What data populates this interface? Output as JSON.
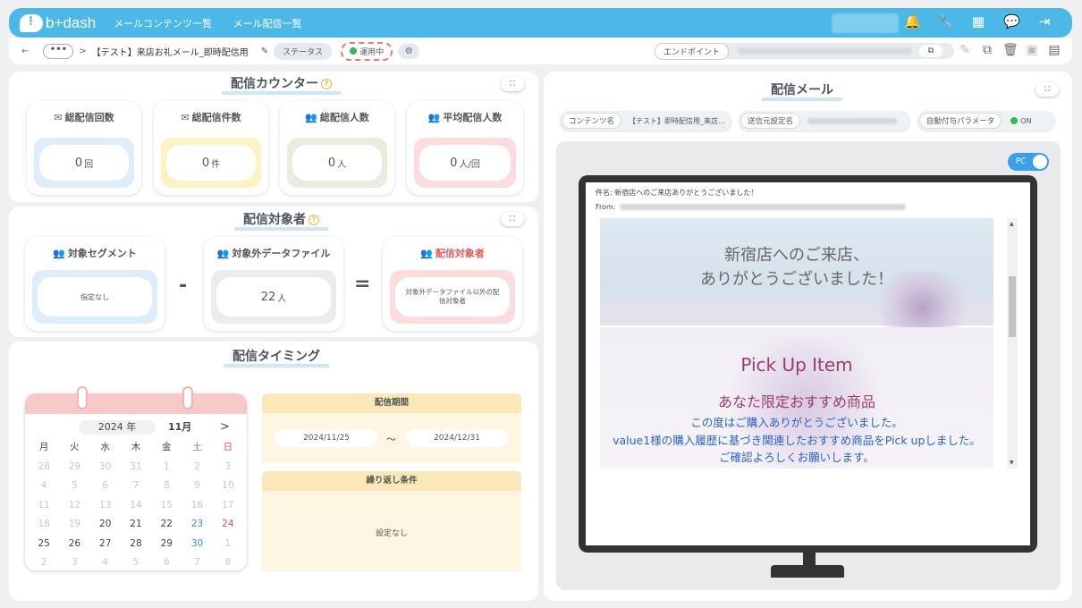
{
  "app": {
    "logo": "b+dash"
  },
  "topnav": [
    "メールコンテンツ一覧",
    "メール配信一覧"
  ],
  "breadcrumb": {
    "back": "←",
    "more": "•••",
    "sep": ">",
    "title": "【テスト】来店お礼メール_即時配信用",
    "status_label": "ステータス",
    "status_value": "運用中",
    "endpoint_label": "エンドポイント"
  },
  "counter": {
    "title": "配信カウンター",
    "cards": [
      {
        "label": "総配信回数",
        "value": "0",
        "unit": "回",
        "color": "#deedf9"
      },
      {
        "label": "総配信件数",
        "value": "0",
        "unit": "件",
        "color": "#fdf2c4"
      },
      {
        "label": "総配信人数",
        "value": "0",
        "unit": "人",
        "color": "#e8eedd"
      },
      {
        "label": "平均配信人数",
        "value": "0",
        "unit": "人/回",
        "color": "#fcdcdc"
      }
    ]
  },
  "target": {
    "title": "配信対象者",
    "segment_label": "対象セグメント",
    "segment_value": "指定なし",
    "exclude_label": "対象外データファイル",
    "exclude_value": "22",
    "exclude_unit": "人",
    "result_label": "配信対象者",
    "result_value": "対象外データファイル以外の配信対象者",
    "minus": "-",
    "equals": "="
  },
  "timing": {
    "title": "配信タイミング",
    "calendar": {
      "year": "2024 年",
      "month": "11月",
      "next": ">",
      "weekdays": [
        "月",
        "火",
        "水",
        "木",
        "金",
        "土",
        "日"
      ],
      "weeks": [
        [
          "28",
          "29",
          "30",
          "31",
          "1",
          "2",
          "3"
        ],
        [
          "4",
          "5",
          "6",
          "7",
          "8",
          "9",
          "10"
        ],
        [
          "11",
          "12",
          "13",
          "14",
          "15",
          "16",
          "17"
        ],
        [
          "18",
          "19",
          "20",
          "21",
          "22",
          "23",
          "24"
        ],
        [
          "25",
          "26",
          "27",
          "28",
          "29",
          "30",
          "1"
        ],
        [
          "2",
          "3",
          "4",
          "5",
          "6",
          "7",
          "8"
        ]
      ]
    },
    "period_label": "配信期間",
    "period_start": "2024/11/25",
    "period_tilde": "～",
    "period_end": "2024/12/31",
    "repeat_label": "繰り返し条件",
    "repeat_value": "設定なし"
  },
  "mail": {
    "title": "配信メール",
    "content_label": "コンテンツ名",
    "content_value": "【テスト】即時配信用_来店...",
    "sender_label": "送信元設定名",
    "param_label": "自動付与パラメータ",
    "param_value": "ON",
    "device_toggle": "PC",
    "subject": "件名: 新宿店へのご来店ありがとうございました！",
    "from_label": "From:",
    "hero_line1": "新宿店へのご来店、",
    "hero_line2": "ありがとうございました！",
    "pickup": "Pick Up Item",
    "recommend": "あなた限定おすすめ商品",
    "msg_line1": "この度はご購入ありがとうございました。",
    "msg_line2": "value1様の購入履歴に基づき関連したおすすめ商品をPick upしました。",
    "msg_line3": "ご確認よろしくお願いします。"
  }
}
